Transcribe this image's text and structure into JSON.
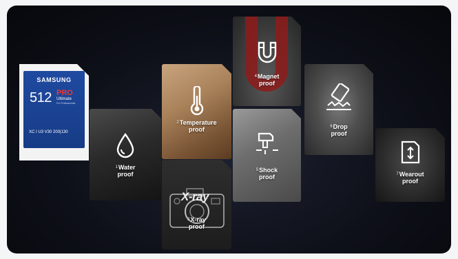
{
  "card": {
    "brand": "SAMSUNG",
    "capacity": "512",
    "tier": "PRO",
    "edition": "Ultimate",
    "subline": "For Professionals",
    "specs": "XC I U3 V30 200|130"
  },
  "features": [
    {
      "number": "1",
      "line1": "Water",
      "line2": "proof",
      "icon": "water-drop-icon"
    },
    {
      "number": "2",
      "line1": "Temperature",
      "line2": "proof",
      "icon": "thermometer-icon"
    },
    {
      "number": "3",
      "line1": "X-ray",
      "line2": "proof",
      "icon": "xray-camera-icon",
      "watermark": "X-ray"
    },
    {
      "number": "4",
      "line1": "Magnet",
      "line2": "proof",
      "icon": "magnet-icon"
    },
    {
      "number": "5",
      "line1": "Shock",
      "line2": "proof",
      "icon": "hammer-icon"
    },
    {
      "number": "6",
      "line1": "Drop",
      "line2": "proof",
      "icon": "falling-card-icon"
    },
    {
      "number": "7",
      "line1": "Wearout",
      "line2": "proof",
      "icon": "card-insert-icon"
    }
  ],
  "colors": {
    "panel_background": "#0e1019",
    "card_blue": "#1f4aa0",
    "pro_red": "#e83a3a",
    "magnet_red": "#8e1b1b"
  }
}
